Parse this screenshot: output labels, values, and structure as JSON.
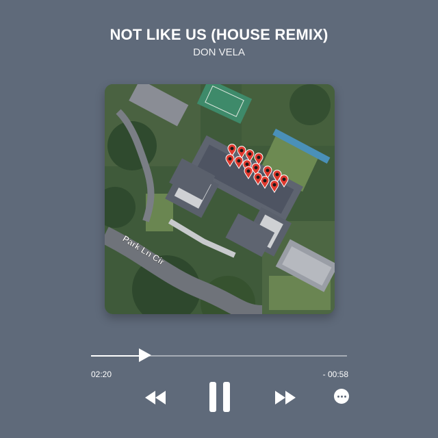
{
  "track": {
    "title": "NOT LIKE US (HOUSE REMIX)",
    "artist": "DON VELA"
  },
  "artwork": {
    "description_icon": "aerial-map-image",
    "street_label": "Park Ln Cir"
  },
  "progress": {
    "elapsed": "02:20",
    "remaining": "- 00:58",
    "fraction": 0.19
  },
  "controls": {
    "rewind_icon": "rewind-icon",
    "pause_icon": "pause-icon",
    "forward_icon": "fast-forward-icon",
    "more_icon": "more-options-icon"
  },
  "colors": {
    "background": "#5f6a7a",
    "foreground": "#ffffff",
    "marker": "#e03a2f"
  }
}
